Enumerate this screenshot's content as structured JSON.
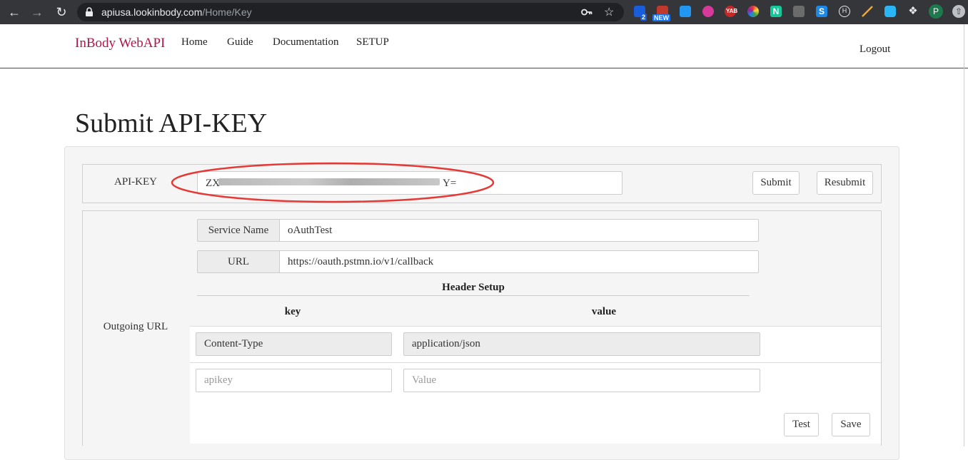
{
  "browser": {
    "url_host": "apiusa.lookinbody.com",
    "url_path": "/Home/Key",
    "extension_badges": {
      "bitwarden": "2",
      "new": "NEW",
      "yab": "YAB"
    },
    "profile_initial": "P",
    "extension_letters": {
      "notion": "N",
      "s": "S",
      "h": "H"
    }
  },
  "nav": {
    "brand": "InBody WebAPI",
    "links": [
      "Home",
      "Guide",
      "Documentation",
      "SETUP"
    ],
    "logout": "Logout"
  },
  "page": {
    "title": "Submit API-KEY"
  },
  "api_key": {
    "label": "API-KEY",
    "value": "ZX",
    "value_tail": "Y=",
    "submit": "Submit",
    "resubmit": "Resubmit"
  },
  "outgoing": {
    "label": "Outgoing URL",
    "service_name_label": "Service Name",
    "service_name_value": "oAuthTest",
    "url_label": "URL",
    "url_value": "https://oauth.pstmn.io/v1/callback",
    "header_setup": "Header Setup",
    "col_key": "key",
    "col_value": "value",
    "rows": [
      {
        "key": "Content-Type",
        "value": "application/json"
      }
    ],
    "new_key_placeholder": "apikey",
    "new_value_placeholder": "Value",
    "test": "Test",
    "save": "Save"
  },
  "colors": {
    "brand": "#b0154a",
    "nav_border": "#8b2560",
    "annotation": "#e53935"
  }
}
